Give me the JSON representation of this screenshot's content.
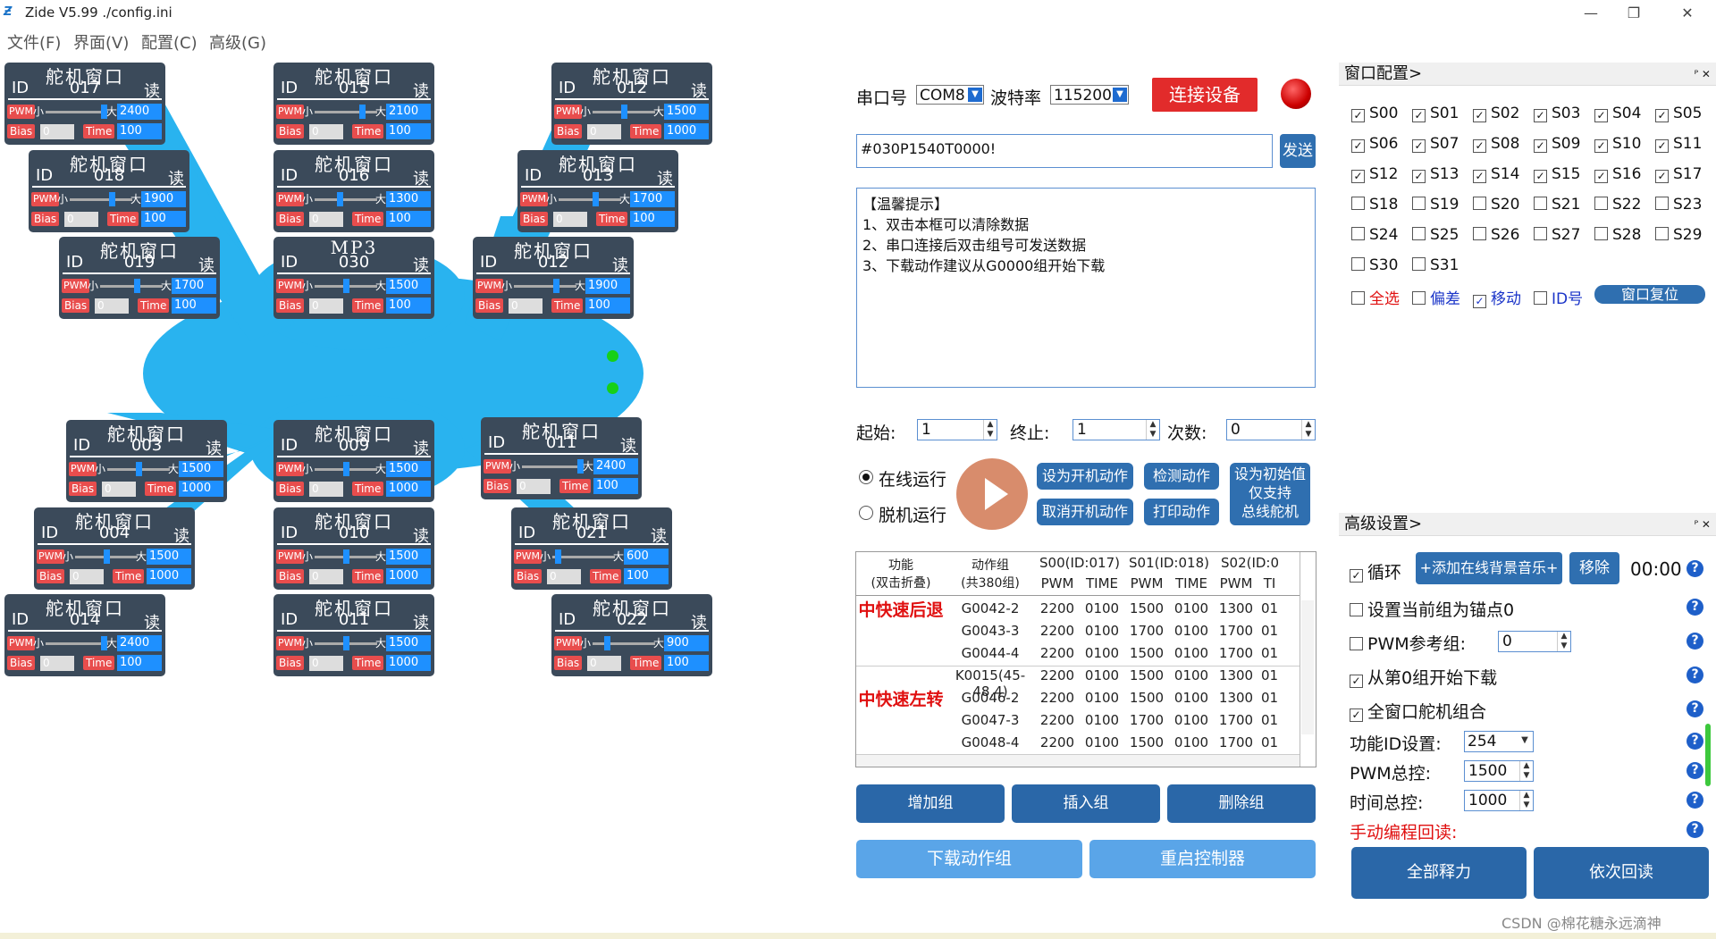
{
  "window": {
    "title": "Zide V5.99 ./config.ini",
    "minimize": "—",
    "maximize": "❐",
    "close": "✕"
  },
  "menu": [
    "文件(F)",
    "界面(V)",
    "配置(C)",
    "高级(G)"
  ],
  "colors": {
    "accent": "#2a67a8",
    "blob": "#29b3ef",
    "servo_bg": "#3b4a5a",
    "red": "#e22b2b"
  },
  "servos": [
    {
      "title": "舵机窗口",
      "id_label": "ID",
      "id": "017",
      "read": "读",
      "pwm": "PWM",
      "min": "小",
      "max": "大",
      "value": "2400",
      "bias_label": "Bias",
      "bias": "0",
      "time_label": "Time",
      "time": "100",
      "level": 0.98
    },
    {
      "title": "舵机窗口",
      "id_label": "ID",
      "id": "018",
      "read": "读",
      "pwm": "PWM",
      "min": "小",
      "max": "大",
      "value": "1900",
      "bias_label": "Bias",
      "bias": "0",
      "time_label": "Time",
      "time": "100",
      "level": 0.7
    },
    {
      "title": "舵机窗口",
      "id_label": "ID",
      "id": "019",
      "read": "读",
      "pwm": "PWM",
      "min": "小",
      "max": "大",
      "value": "1700",
      "bias_label": "Bias",
      "bias": "0",
      "time_label": "Time",
      "time": "100",
      "level": 0.6
    },
    {
      "title": "舵机窗口",
      "id_label": "ID",
      "id": "015",
      "read": "读",
      "pwm": "PWM",
      "min": "小",
      "max": "大",
      "value": "2100",
      "bias_label": "Bias",
      "bias": "0",
      "time_label": "Time",
      "time": "100",
      "level": 0.8
    },
    {
      "title": "舵机窗口",
      "id_label": "ID",
      "id": "016",
      "read": "读",
      "pwm": "PWM",
      "min": "小",
      "max": "大",
      "value": "1300",
      "bias_label": "Bias",
      "bias": "0",
      "time_label": "Time",
      "time": "100",
      "level": 0.4
    },
    {
      "title": "MP3",
      "id_label": "ID",
      "id": "030",
      "read": "读",
      "pwm": "PWM",
      "min": "小",
      "max": "大",
      "value": "1500",
      "bias_label": "Bias",
      "bias": "0",
      "time_label": "Time",
      "time": "100",
      "level": 0.5
    },
    {
      "title": "舵机窗口",
      "id_label": "ID",
      "id": "012",
      "read": "读",
      "pwm": "PWM",
      "min": "小",
      "max": "大",
      "value": "1500",
      "bias_label": "Bias",
      "bias": "0",
      "time_label": "Time",
      "time": "1000",
      "level": 0.5
    },
    {
      "title": "舵机窗口",
      "id_label": "ID",
      "id": "013",
      "read": "读",
      "pwm": "PWM",
      "min": "小",
      "max": "大",
      "value": "1700",
      "bias_label": "Bias",
      "bias": "0",
      "time_label": "Time",
      "time": "100",
      "level": 0.6
    },
    {
      "title": "舵机窗口",
      "id_label": "ID",
      "id": "012",
      "read": "读",
      "pwm": "PWM",
      "min": "小",
      "max": "大",
      "value": "1900",
      "bias_label": "Bias",
      "bias": "0",
      "time_label": "Time",
      "time": "100",
      "level": 0.7
    },
    {
      "title": "舵机窗口",
      "id_label": "ID",
      "id": "003",
      "read": "读",
      "pwm": "PWM",
      "min": "小",
      "max": "大",
      "value": "1500",
      "bias_label": "Bias",
      "bias": "0",
      "time_label": "Time",
      "time": "1000",
      "level": 0.5
    },
    {
      "title": "舵机窗口",
      "id_label": "ID",
      "id": "004",
      "read": "读",
      "pwm": "PWM",
      "min": "小",
      "max": "大",
      "value": "1500",
      "bias_label": "Bias",
      "bias": "0",
      "time_label": "Time",
      "time": "1000",
      "level": 0.5
    },
    {
      "title": "舵机窗口",
      "id_label": "ID",
      "id": "014",
      "read": "读",
      "pwm": "PWM",
      "min": "小",
      "max": "大",
      "value": "2400",
      "bias_label": "Bias",
      "bias": "0",
      "time_label": "Time",
      "time": "100",
      "level": 0.98
    },
    {
      "title": "舵机窗口",
      "id_label": "ID",
      "id": "009",
      "read": "读",
      "pwm": "PWM",
      "min": "小",
      "max": "大",
      "value": "1500",
      "bias_label": "Bias",
      "bias": "0",
      "time_label": "Time",
      "time": "1000",
      "level": 0.5
    },
    {
      "title": "舵机窗口",
      "id_label": "ID",
      "id": "010",
      "read": "读",
      "pwm": "PWM",
      "min": "小",
      "max": "大",
      "value": "1500",
      "bias_label": "Bias",
      "bias": "0",
      "time_label": "Time",
      "time": "1000",
      "level": 0.5
    },
    {
      "title": "舵机窗口",
      "id_label": "ID",
      "id": "011",
      "read": "读",
      "pwm": "PWM",
      "min": "小",
      "max": "大",
      "value": "1500",
      "bias_label": "Bias",
      "bias": "0",
      "time_label": "Time",
      "time": "1000",
      "level": 0.5
    },
    {
      "title": "舵机窗口",
      "id_label": "ID",
      "id": "011",
      "read": "读",
      "pwm": "PWM",
      "min": "小",
      "max": "大",
      "value": "2400",
      "bias_label": "Bias",
      "bias": "0",
      "time_label": "Time",
      "time": "100",
      "level": 0.98
    },
    {
      "title": "舵机窗口",
      "id_label": "ID",
      "id": "021",
      "read": "读",
      "pwm": "PWM",
      "min": "小",
      "max": "大",
      "value": "600",
      "bias_label": "Bias",
      "bias": "0",
      "time_label": "Time",
      "time": "100",
      "level": 0.05
    },
    {
      "title": "舵机窗口",
      "id_label": "ID",
      "id": "022",
      "read": "读",
      "pwm": "PWM",
      "min": "小",
      "max": "大",
      "value": "900",
      "bias_label": "Bias",
      "bias": "0",
      "time_label": "Time",
      "time": "100",
      "level": 0.2
    }
  ],
  "serial": {
    "port_label": "串口号",
    "port": "COM8",
    "baud_label": "波特率",
    "baud": "115200",
    "connect": "连接设备",
    "command": "#030P1540T0000!",
    "send": "发送"
  },
  "tips": {
    "title": "【温馨提示】",
    "lines": [
      "1、双击本框可以清除数据",
      "2、串口连接后双击组号可发送数据",
      "3、下载动作建议从G0000组开始下载"
    ]
  },
  "range": {
    "start_label": "起始:",
    "start": "1",
    "end_label": "终止:",
    "end": "1",
    "count_label": "次数:",
    "count": "0"
  },
  "run": {
    "online": "在线运行",
    "offline": "脱机运行",
    "set_boot": "设为开机动作",
    "cancel_boot": "取消开机动作",
    "check": "检测动作",
    "print": "打印动作",
    "set_init": "设为初始值",
    "set_init2": "仅支持",
    "set_init3": "总线舵机"
  },
  "table": {
    "headers": {
      "func": "功能",
      "func_sub": "(双击折叠)",
      "group": "动作组",
      "group_sub": "(共380组)",
      "s00": "S00(ID:017)",
      "s01": "S01(ID:018)",
      "s02": "S02(ID:0",
      "pwm": "PWM",
      "time": "TIME",
      "ti": "TI"
    },
    "func_a": "中快速后退",
    "func_b": "中快速左转",
    "rows": [
      {
        "group": "G0042-2",
        "p0": "2200",
        "t0": "0100",
        "p1": "1500",
        "t1": "0100",
        "p2": "1300",
        "t2": "01"
      },
      {
        "group": "G0043-3",
        "p0": "2200",
        "t0": "0100",
        "p1": "1700",
        "t1": "0100",
        "p2": "1700",
        "t2": "01"
      },
      {
        "group": "G0044-4",
        "p0": "2200",
        "t0": "0100",
        "p1": "1500",
        "t1": "0100",
        "p2": "1700",
        "t2": "01"
      },
      {
        "group": "K0015(45-48,4)",
        "p0": "2200",
        "t0": "0100",
        "p1": "1500",
        "t1": "0100",
        "p2": "1300",
        "t2": "01"
      },
      {
        "group": "G0046-2",
        "p0": "2200",
        "t0": "0100",
        "p1": "1500",
        "t1": "0100",
        "p2": "1300",
        "t2": "01"
      },
      {
        "group": "G0047-3",
        "p0": "2200",
        "t0": "0100",
        "p1": "1700",
        "t1": "0100",
        "p2": "1700",
        "t2": "01"
      },
      {
        "group": "G0048-4",
        "p0": "2200",
        "t0": "0100",
        "p1": "1500",
        "t1": "0100",
        "p2": "1700",
        "t2": "01"
      }
    ]
  },
  "group_buttons": {
    "add": "增加组",
    "insert": "插入组",
    "delete": "删除组",
    "download": "下载动作组",
    "restart": "重启控制器"
  },
  "window_config": {
    "title": "窗口配置>",
    "ctl": "ᴾ ✕",
    "servos": [
      {
        "label": "S00",
        "checked": true
      },
      {
        "label": "S01",
        "checked": true
      },
      {
        "label": "S02",
        "checked": true
      },
      {
        "label": "S03",
        "checked": true
      },
      {
        "label": "S04",
        "checked": true
      },
      {
        "label": "S05",
        "checked": true
      },
      {
        "label": "S06",
        "checked": true
      },
      {
        "label": "S07",
        "checked": true
      },
      {
        "label": "S08",
        "checked": true
      },
      {
        "label": "S09",
        "checked": true
      },
      {
        "label": "S10",
        "checked": true
      },
      {
        "label": "S11",
        "checked": true
      },
      {
        "label": "S12",
        "checked": true
      },
      {
        "label": "S13",
        "checked": true
      },
      {
        "label": "S14",
        "checked": true
      },
      {
        "label": "S15",
        "checked": true
      },
      {
        "label": "S16",
        "checked": true
      },
      {
        "label": "S17",
        "checked": true
      },
      {
        "label": "S18",
        "checked": false
      },
      {
        "label": "S19",
        "checked": false
      },
      {
        "label": "S20",
        "checked": false
      },
      {
        "label": "S21",
        "checked": false
      },
      {
        "label": "S22",
        "checked": false
      },
      {
        "label": "S23",
        "checked": false
      },
      {
        "label": "S24",
        "checked": false
      },
      {
        "label": "S25",
        "checked": false
      },
      {
        "label": "S26",
        "checked": false
      },
      {
        "label": "S27",
        "checked": false
      },
      {
        "label": "S28",
        "checked": false
      },
      {
        "label": "S29",
        "checked": false
      },
      {
        "label": "S30",
        "checked": false
      },
      {
        "label": "S31",
        "checked": false
      }
    ],
    "select_all": "全选",
    "bias": "偏差",
    "move": "移动",
    "id_num": "ID号",
    "reset": "窗口复位"
  },
  "advanced": {
    "title": "高级设置>",
    "ctl": "ᴾ ✕",
    "loop": "循环",
    "add_music": "+添加在线背景音乐+",
    "remove": "移除",
    "time": "00:00",
    "anchor": "设置当前组为锚点0",
    "pwm_ref": "PWM参考组:",
    "pwm_ref_val": "0",
    "from_zero": "从第0组开始下载",
    "combine": "全窗口舵机组合",
    "func_id": "功能ID设置:",
    "func_id_val": "254",
    "pwm_total": "PWM总控:",
    "pwm_total_val": "1500",
    "time_total": "时间总控:",
    "time_total_val": "1000",
    "manual_read": "手动编程回读:",
    "release_all": "全部释力",
    "read_seq": "依次回读",
    "help": "?"
  },
  "footer": "CSDN @棉花糖永远滴神"
}
